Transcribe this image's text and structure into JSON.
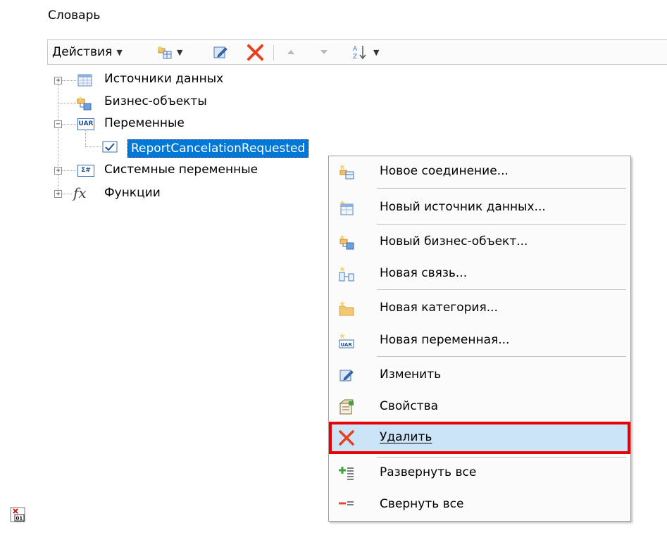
{
  "panel": {
    "title": "Словарь"
  },
  "toolbar": {
    "actions_label": "Действия",
    "icons": [
      "new-item-icon",
      "edit-icon",
      "delete-icon",
      "move-up-icon",
      "move-down-icon",
      "sort-icon"
    ]
  },
  "tree": {
    "data_sources": "Источники данных",
    "business_objects": "Бизнес-объекты",
    "variables": "Переменные",
    "selected_variable": "ReportCancelationRequested",
    "system_variables": "Системные переменные",
    "functions": "Функции",
    "variable_icon_text": "UAR",
    "system_icon_text": "Σ#",
    "function_icon_text": "fx"
  },
  "context_menu": {
    "items": [
      {
        "label": "Новое соединение...",
        "icon": "new-connection-icon"
      },
      {
        "label": "Новый источник данных...",
        "icon": "new-data-source-icon"
      },
      {
        "label": "Новый бизнес-объект...",
        "icon": "new-business-object-icon"
      },
      {
        "label": "Новая связь...",
        "icon": "new-relation-icon"
      },
      {
        "label": "Новая категория...",
        "icon": "new-category-icon"
      },
      {
        "label": "Новая переменная...",
        "icon": "new-variable-icon"
      },
      {
        "label": "Изменить",
        "icon": "edit-icon"
      },
      {
        "label": "Свойства",
        "icon": "properties-icon"
      },
      {
        "label": "Удалить",
        "icon": "delete-icon",
        "highlighted": true
      },
      {
        "label": "Развернуть все",
        "icon": "expand-all-icon"
      },
      {
        "label": "Свернуть все",
        "icon": "collapse-all-icon"
      }
    ],
    "accent_colors": {
      "highlight_fill": "#cce4f7",
      "highlight_border": "#ea0000",
      "selection": "#0078d7"
    }
  },
  "bottom_icon_text": "01"
}
